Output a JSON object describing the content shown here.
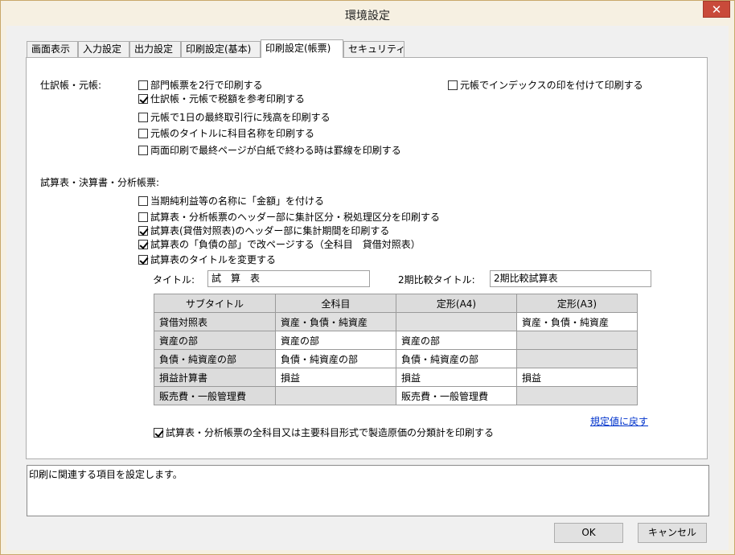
{
  "window": {
    "title": "環境設定",
    "close_glyph": "✕"
  },
  "tabs": [
    {
      "label": "画面表示"
    },
    {
      "label": "入力設定"
    },
    {
      "label": "出力設定"
    },
    {
      "label": "印刷設定(基本)"
    },
    {
      "label": "印刷設定(帳票)",
      "active": true
    },
    {
      "label": "セキュリティ"
    }
  ],
  "journal_section": {
    "label": "仕訳帳・元帳:",
    "options": [
      {
        "label": "部門帳票を2行で印刷する",
        "checked": false
      },
      {
        "label": "仕訳帳・元帳で税額を参考印刷する",
        "checked": true
      },
      {
        "label": "元帳で1日の最終取引行に残高を印刷する",
        "checked": false
      },
      {
        "label": "元帳のタイトルに科目名称を印刷する",
        "checked": false
      },
      {
        "label": "両面印刷で最終ページが白紙で終わる時は罫線を印刷する",
        "checked": false
      }
    ],
    "index_option": {
      "label": "元帳でインデックスの印を付けて印刷する",
      "checked": false
    }
  },
  "trial_section": {
    "label": "試算表・決算書・分析帳票:",
    "options": [
      {
        "label": "当期純利益等の名称に「金額」を付ける",
        "checked": false
      },
      {
        "label": "試算表・分析帳票のヘッダー部に集計区分・税処理区分を印刷する",
        "checked": false
      },
      {
        "label": "試算表(貸借対照表)のヘッダー部に集計期間を印刷する",
        "checked": true
      },
      {
        "label": "試算表の「負債の部」で改ページする（全科目　貸借対照表）",
        "checked": true
      },
      {
        "label": "試算表のタイトルを変更する",
        "checked": true
      }
    ],
    "title_label": "タイトル:",
    "title_value": "試　算　表",
    "compare_label": "2期比較タイトル:",
    "compare_value": "2期比較試算表"
  },
  "subtitle_table": {
    "headers": [
      "サブタイトル",
      "全科目",
      "定形(A4)",
      "定形(A3)"
    ],
    "rows": [
      {
        "label": "貸借対照表",
        "cells": [
          "資産・負債・純資産",
          "",
          "資産・負債・純資産"
        ],
        "enabled": [
          false,
          false,
          true
        ]
      },
      {
        "label": "資産の部",
        "cells": [
          "資産の部",
          "資産の部",
          ""
        ],
        "enabled": [
          true,
          true,
          false
        ]
      },
      {
        "label": "負債・純資産の部",
        "cells": [
          "負債・純資産の部",
          "負債・純資産の部",
          ""
        ],
        "enabled": [
          true,
          true,
          false
        ]
      },
      {
        "label": "損益計算書",
        "cells": [
          "損益",
          "損益",
          "損益"
        ],
        "enabled": [
          true,
          true,
          true
        ]
      },
      {
        "label": "販売費・一般管理費",
        "cells": [
          "",
          "販売費・一般管理費",
          ""
        ],
        "enabled": [
          false,
          true,
          false
        ]
      }
    ]
  },
  "reset_link": "規定値に戻す",
  "cost_option": {
    "label": "試算表・分析帳票の全科目又は主要科目形式で製造原価の分類計を印刷する",
    "checked": true
  },
  "description": "印刷に関連する項目を設定します。",
  "buttons": {
    "ok": "OK",
    "cancel": "キャンセル"
  }
}
